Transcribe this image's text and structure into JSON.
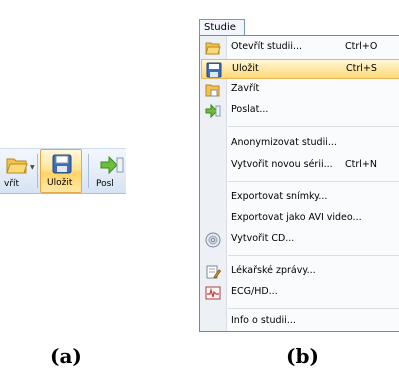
{
  "toolbar": {
    "open_label": "vřít",
    "save_label": "Uložit",
    "send_label": "Posl"
  },
  "menu": {
    "title": "Studie",
    "items": [
      {
        "label": "Otevřít studii...",
        "shortcut": "Ctrl+O",
        "icon": "folder-open-icon"
      },
      {
        "label": "Uložit",
        "shortcut": "Ctrl+S",
        "icon": "floppy-disk-icon",
        "highlighted": true
      },
      {
        "label": "Zavřít",
        "shortcut": "",
        "icon": "folder-close-icon"
      },
      {
        "label": "Poslat...",
        "shortcut": "",
        "icon": "send-arrow-icon"
      },
      {
        "label": "Anonymizovat studii...",
        "shortcut": "",
        "icon": ""
      },
      {
        "label": "Vytvořit novou sérii...",
        "shortcut": "Ctrl+N",
        "icon": ""
      },
      {
        "label": "Exportovat snímky...",
        "shortcut": "",
        "icon": ""
      },
      {
        "label": "Exportovat jako AVI video...",
        "shortcut": "",
        "icon": ""
      },
      {
        "label": "Vytvořit CD...",
        "shortcut": "",
        "icon": "cd-disc-icon"
      },
      {
        "label": "Lékařské zprávy...",
        "shortcut": "",
        "icon": "report-edit-icon"
      },
      {
        "label": "ECG/HD...",
        "shortcut": "",
        "icon": "ecg-waveform-icon"
      },
      {
        "label": "Info o studii...",
        "shortcut": "",
        "icon": ""
      }
    ]
  },
  "captions": {
    "a": "(a)",
    "b": "(b)"
  },
  "colors": {
    "highlight": "#ffe7a4",
    "highlight_border": "#e8b955",
    "menu_border": "#7b95c2"
  }
}
